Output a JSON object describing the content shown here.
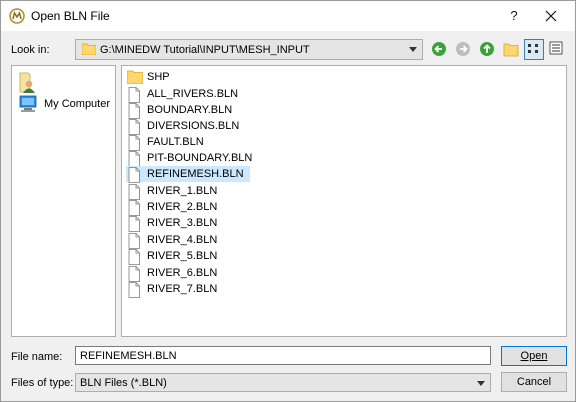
{
  "window": {
    "title": "Open BLN File"
  },
  "titlebar": {
    "help_label": "?"
  },
  "lookin": {
    "label": "Look in:",
    "path": "G:\\MINEDW Tutorial\\INPUT\\MESH_INPUT"
  },
  "sidebar": {
    "items": [
      {
        "label": ""
      },
      {
        "label": "My Computer"
      }
    ]
  },
  "files": {
    "folders": [
      "SHP"
    ],
    "items": [
      "ALL_RIVERS.BLN",
      "BOUNDARY.BLN",
      "DIVERSIONS.BLN",
      "FAULT.BLN",
      "PIT-BOUNDARY.BLN",
      "REFINEMESH.BLN",
      "RIVER_1.BLN",
      "RIVER_2.BLN",
      "RIVER_3.BLN",
      "RIVER_4.BLN",
      "RIVER_5.BLN",
      "RIVER_6.BLN",
      "RIVER_7.BLN"
    ],
    "selected": "REFINEMESH.BLN"
  },
  "form": {
    "filename_label": "File name:",
    "filename_value": "REFINEMESH.BLN",
    "filetype_label": "Files of type:",
    "filetype_value": "BLN Files (*.BLN)"
  },
  "buttons": {
    "open_label": "Open",
    "cancel_label": "Cancel"
  },
  "colors": {
    "selection": "#cce8ff",
    "accent": "#0078d7",
    "folder": "#ffd76e"
  }
}
